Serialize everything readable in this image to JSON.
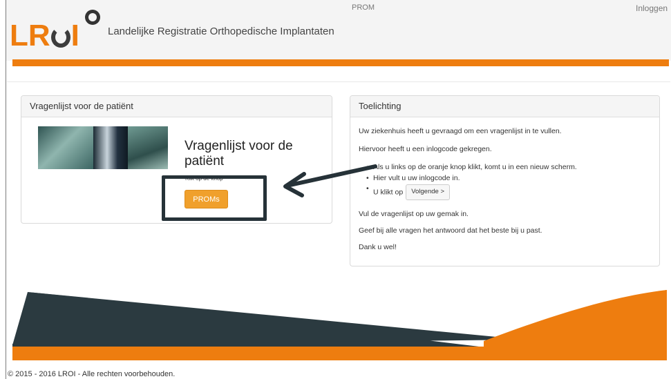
{
  "header": {
    "logo_text_l": "LR",
    "logo_text_i": "I",
    "site_title": "Landelijke Registratie Orthopedische Implantaten",
    "nav_prom": "PROM",
    "nav_login": "Inloggen"
  },
  "left_panel": {
    "heading": "Vragenlijst voor de patiënt",
    "card_title": "Vragenlijst voor de patiënt",
    "card_sub": "Klik op de knop",
    "button": "PROMs"
  },
  "right_panel": {
    "heading": "Toelichting",
    "line1": "Uw ziekenhuis heeft u gevraagd om een vragenlijst in te vullen.",
    "line2": "Hiervoor heeft u een inlogcode gekregen.",
    "bullet1": "Als u links op de oranje knop klikt, komt u in een nieuw scherm.",
    "bullet2": "Hier vult u uw inlogcode in.",
    "bullet3": "U klikt op",
    "next_button": "Volgende",
    "next_icon": "chevron-right-icon",
    "line3": "Vul de vragenlijst op uw gemak in.",
    "line4": "Geef bij alle vragen het antwoord dat het beste bij u past.",
    "line5": "Dank u wel!"
  },
  "footer": {
    "copyright": "© 2015 - 2016 LROI - Alle rechten voorbehouden."
  },
  "colors": {
    "brand_orange": "#ee7d0f",
    "button_orange": "#f0a02c",
    "dark": "#263238"
  }
}
